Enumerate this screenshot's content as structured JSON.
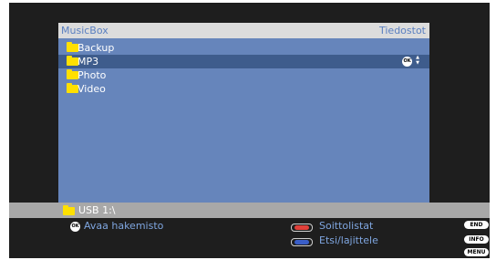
{
  "panel": {
    "title": "MusicBox",
    "section": "Tiedostot",
    "items": [
      {
        "label": "Backup"
      },
      {
        "label": "MP3",
        "selected": true
      },
      {
        "label": "Photo"
      },
      {
        "label": "Video"
      }
    ],
    "ok_badge": "OK",
    "scroll_indicator": "▲▼"
  },
  "status": {
    "path": "USB 1:\\"
  },
  "footer": {
    "ok_badge": "OK",
    "open_label": "Avaa hakemisto",
    "red_label": "Soittolistat",
    "blue_label": "Etsi/lajittele",
    "end_label": "END",
    "info_label": "INFO",
    "menu_label": "MENU"
  },
  "colors": {
    "panel": "#6685bb",
    "selected_row": "#3e5c8c",
    "folder": "#ffe000",
    "red_key": "#e0403a",
    "blue_key": "#3a5ec8",
    "footer_text": "#7fa6e0"
  }
}
